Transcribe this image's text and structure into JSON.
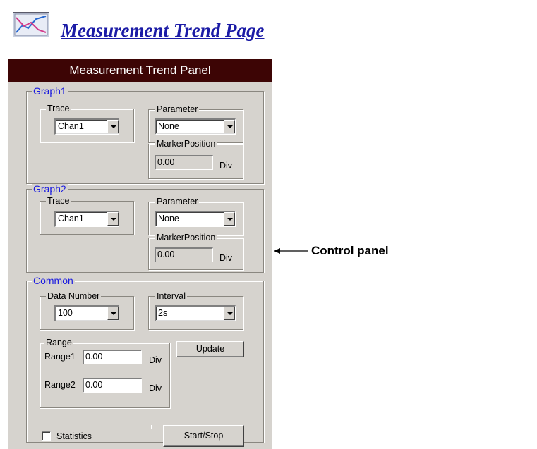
{
  "page": {
    "title": "Measurement Trend Page"
  },
  "panel": {
    "title": "Measurement Trend Panel",
    "graph1": {
      "label": "Graph1",
      "trace": {
        "label": "Trace",
        "value": "Chan1"
      },
      "parameter": {
        "label": "Parameter",
        "value": "None"
      },
      "marker_position": {
        "label": "MarkerPosition",
        "value": "0.00",
        "unit": "Div"
      }
    },
    "graph2": {
      "label": "Graph2",
      "trace": {
        "label": "Trace",
        "value": "Chan1"
      },
      "parameter": {
        "label": "Parameter",
        "value": "None"
      },
      "marker_position": {
        "label": "MarkerPosition",
        "value": "0.00",
        "unit": "Div"
      }
    },
    "common": {
      "label": "Common",
      "data_number": {
        "label": "Data Number",
        "value": "100"
      },
      "interval": {
        "label": "Interval",
        "value": "2s"
      },
      "range": {
        "label": "Range",
        "range1": {
          "label": "Range1",
          "value": "0.00",
          "unit": "Div"
        },
        "range2": {
          "label": "Range2",
          "value": "0.00",
          "unit": "Div"
        }
      },
      "update_button": "Update",
      "statistics": {
        "label": "Statistics",
        "checked": false
      },
      "start_stop_button": "Start/Stop"
    }
  },
  "annotation": {
    "label": "Control panel"
  },
  "colors": {
    "titlebar": "#3d0505",
    "panel_bg": "#d6d3ce",
    "group_label": "#1a1ae0",
    "page_title": "#1b1ba6"
  },
  "icons": {
    "page_icon": "trend-chart-icon"
  }
}
